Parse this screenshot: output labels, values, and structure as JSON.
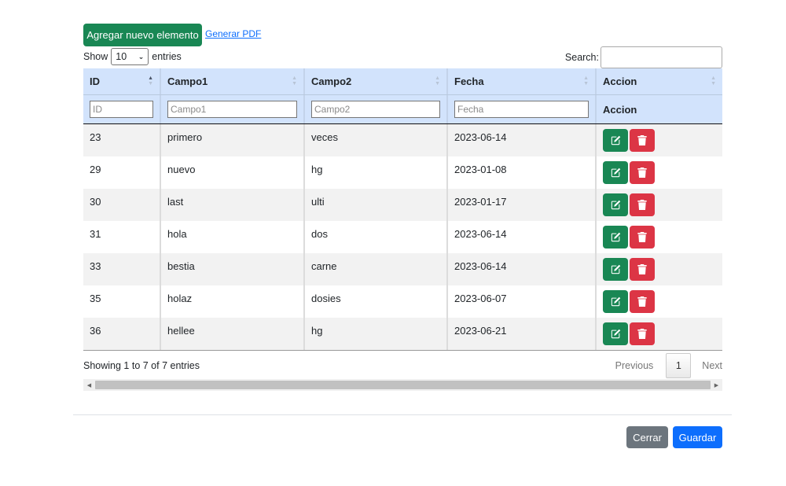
{
  "toolbar": {
    "add_label": "Agregar nuevo elemento",
    "pdf_label": "Generar PDF"
  },
  "length": {
    "show_label": "Show",
    "value": "10",
    "entries_label": "entries"
  },
  "search": {
    "label": "Search:",
    "value": ""
  },
  "table": {
    "columns": [
      "ID",
      "Campo1",
      "Campo2",
      "Fecha",
      "Accion"
    ],
    "filters": {
      "id_placeholder": "ID",
      "campo1_placeholder": "Campo1",
      "campo2_placeholder": "Campo2",
      "fecha_placeholder": "Fecha",
      "accion_label": "Accion"
    },
    "rows": [
      {
        "id": "23",
        "campo1": "primero",
        "campo2": "veces",
        "fecha": "2023-06-14"
      },
      {
        "id": "29",
        "campo1": "nuevo",
        "campo2": "hg",
        "fecha": "2023-01-08"
      },
      {
        "id": "30",
        "campo1": "last",
        "campo2": "ulti",
        "fecha": "2023-01-17"
      },
      {
        "id": "31",
        "campo1": "hola",
        "campo2": "dos",
        "fecha": "2023-06-14"
      },
      {
        "id": "33",
        "campo1": "bestia",
        "campo2": "carne",
        "fecha": "2023-06-14"
      },
      {
        "id": "35",
        "campo1": "holaz",
        "campo2": "dosies",
        "fecha": "2023-06-07"
      },
      {
        "id": "36",
        "campo1": "hellee",
        "campo2": "hg",
        "fecha": "2023-06-21"
      }
    ]
  },
  "footer": {
    "info": "Showing 1 to 7 of 7 entries",
    "previous": "Previous",
    "current_page": "1",
    "next": "Next"
  },
  "modal": {
    "close_label": "Cerrar",
    "save_label": "Guardar"
  },
  "colors": {
    "add": "#198754",
    "edit": "#198754",
    "delete": "#dc3545",
    "save": "#0d6efd",
    "close": "#6c757d",
    "header_bg": "#d2e3fc"
  },
  "icons": {
    "edit": "pencil-square-icon",
    "delete": "trash-icon"
  }
}
